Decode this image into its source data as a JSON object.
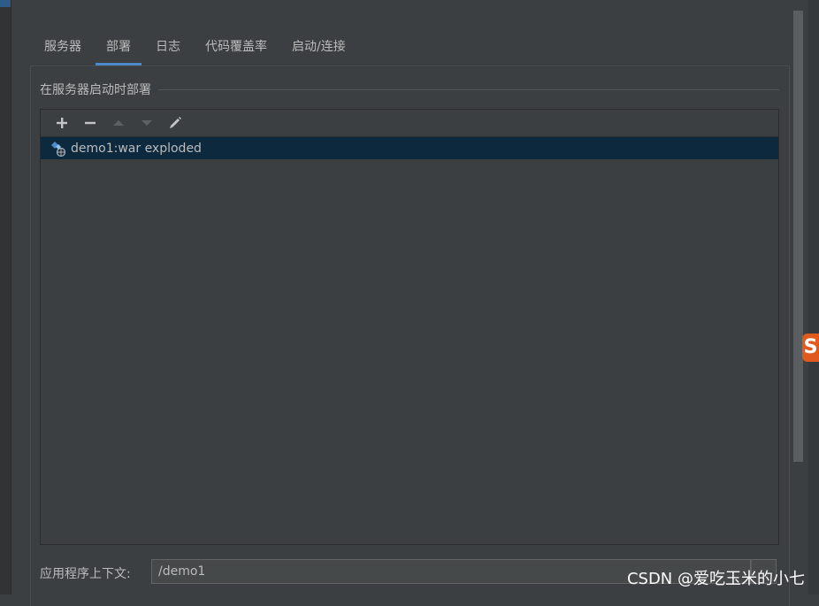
{
  "tabs": [
    {
      "label": "服务器",
      "active": false
    },
    {
      "label": "部署",
      "active": true
    },
    {
      "label": "日志",
      "active": false
    },
    {
      "label": "代码覆盖率",
      "active": false
    },
    {
      "label": "启动/连接",
      "active": false
    }
  ],
  "deploy_section": {
    "title": "在服务器启动时部署",
    "toolbar": {
      "add_icon": "plus-icon",
      "remove_icon": "minus-icon",
      "up_icon": "arrow-up-icon",
      "down_icon": "arrow-down-icon",
      "edit_icon": "pencil-icon"
    },
    "artifacts": [
      {
        "label": "demo1:war exploded",
        "icon": "artifact-web-icon",
        "selected": true
      }
    ]
  },
  "context": {
    "label": "应用程序上下文:",
    "value": "/demo1"
  },
  "watermark": "CSDN @爱吃玉米的小七",
  "logo_letter": "S",
  "colors": {
    "accent": "#4a88c7",
    "selection": "#0d293e",
    "background": "#3c3f41"
  }
}
